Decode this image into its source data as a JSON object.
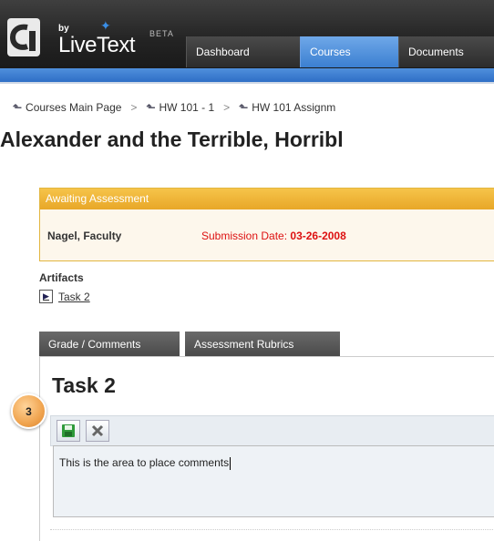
{
  "header": {
    "logo_by": "by",
    "logo_name": "LiveText",
    "logo_beta": "BETA",
    "tabs": [
      {
        "label": "Dashboard"
      },
      {
        "label": "Courses"
      },
      {
        "label": "Documents"
      }
    ]
  },
  "breadcrumb": {
    "items": [
      {
        "label": "Courses Main Page"
      },
      {
        "label": "HW 101 - 1"
      },
      {
        "label": "HW 101 Assignm"
      }
    ],
    "separator": ">"
  },
  "page_title": "Alexander and the Terrible, Horribl",
  "assessment": {
    "status": "Awaiting Assessment",
    "faculty": "Nagel, Faculty",
    "submission_label": "Submission Date:",
    "submission_date": "03-26-2008"
  },
  "artifacts": {
    "heading": "Artifacts",
    "items": [
      {
        "label": "Task 2"
      }
    ]
  },
  "sub_tabs": [
    {
      "label": "Grade / Comments"
    },
    {
      "label": "Assessment Rubrics"
    }
  ],
  "task": {
    "title": "Task 2",
    "step_badge": "3",
    "comment_value": "This is the area to place comments"
  },
  "colors": {
    "accent_blue": "#3b7fd1",
    "awaiting_orange": "#e8a728",
    "date_red": "#dd1111"
  },
  "icons": {
    "save": "save-icon",
    "cancel": "close-icon",
    "breadcrumb": "breadcrumb-up-icon",
    "artifact": "document-icon"
  }
}
